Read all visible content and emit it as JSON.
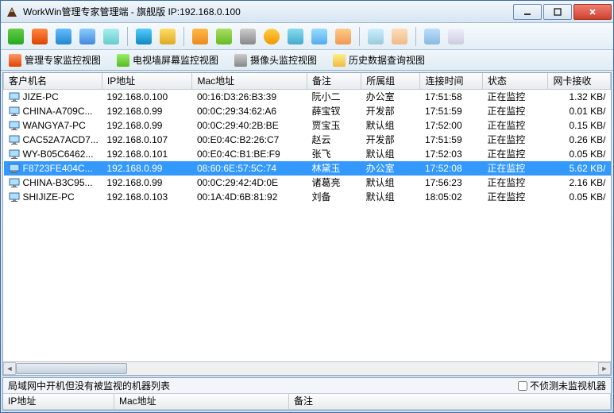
{
  "titlebar": {
    "title": "WorkWin管理专家管理端 - 旗舰版 IP:192.168.0.100"
  },
  "tabs": {
    "t1": "管理专家监控视图",
    "t2": "电视墙屏幕监控视图",
    "t3": "摄像头监控视图",
    "t4": "历史数据查询视图"
  },
  "columns": {
    "c0": "客户机名",
    "c1": "IP地址",
    "c2": "Mac地址",
    "c3": "备注",
    "c4": "所属组",
    "c5": "连接时间",
    "c6": "状态",
    "c7": "网卡接收"
  },
  "rows": [
    {
      "name": "JIZE-PC",
      "ip": "192.168.0.100",
      "mac": "00:16:D3:26:B3:39",
      "remark": "阮小二",
      "group": "办公室",
      "time": "17:51:58",
      "status": "正在监控",
      "net": "1.32 KB/",
      "selected": false
    },
    {
      "name": "CHINA-A709C...",
      "ip": "192.168.0.99",
      "mac": "00:0C:29:34:62:A6",
      "remark": "薛宝钗",
      "group": "开发部",
      "time": "17:51:59",
      "status": "正在监控",
      "net": "0.01 KB/",
      "selected": false
    },
    {
      "name": "WANGYA7-PC",
      "ip": "192.168.0.99",
      "mac": "00:0C:29:40:2B:BE",
      "remark": "贾宝玉",
      "group": "默认组",
      "time": "17:52:00",
      "status": "正在监控",
      "net": "0.15 KB/",
      "selected": false
    },
    {
      "name": "CAC52A7ACD7...",
      "ip": "192.168.0.107",
      "mac": "00:E0:4C:B2:26:C7",
      "remark": "赵云",
      "group": "开发部",
      "time": "17:51:59",
      "status": "正在监控",
      "net": "0.26 KB/",
      "selected": false
    },
    {
      "name": "WY-B05C6462...",
      "ip": "192.168.0.101",
      "mac": "00:E0:4C:B1:BE:F9",
      "remark": "张飞",
      "group": "默认组",
      "time": "17:52:03",
      "status": "正在监控",
      "net": "0.05 KB/",
      "selected": false
    },
    {
      "name": "F8723FE404C...",
      "ip": "192.168.0.99",
      "mac": "08:60:6E:57:5C:74",
      "remark": "林黛玉",
      "group": "办公室",
      "time": "17:52:08",
      "status": "正在监控",
      "net": "5.62 KB/",
      "selected": true
    },
    {
      "name": "CHINA-B3C95...",
      "ip": "192.168.0.99",
      "mac": "00:0C:29:42:4D:0E",
      "remark": "诸葛亮",
      "group": "默认组",
      "time": "17:56:23",
      "status": "正在监控",
      "net": "2.16 KB/",
      "selected": false
    },
    {
      "name": "SHIJIZE-PC",
      "ip": "192.168.0.103",
      "mac": "00:1A:4D:6B:81:92",
      "remark": "刘备",
      "group": "默认组",
      "time": "18:05:02",
      "status": "正在监控",
      "net": "0.05 KB/",
      "selected": false
    }
  ],
  "bottom": {
    "header": "局域网中开机但没有被监视的机器列表",
    "checkbox": "不侦测未监视机器",
    "col_ip": "IP地址",
    "col_mac": "Mac地址",
    "col_remark": "备注"
  }
}
